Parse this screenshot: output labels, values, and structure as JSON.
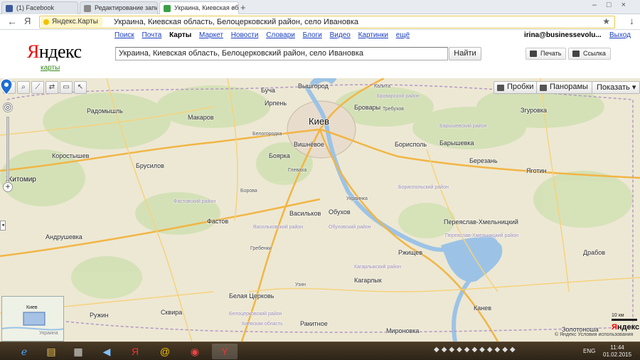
{
  "browser": {
    "tabs": [
      {
        "title": "(1) Facebook",
        "favicon_color": "#3b5998"
      },
      {
        "title": "Редактирование запи",
        "favicon_color": "#8a8a8a"
      },
      {
        "title": "Украина, Киевская об",
        "favicon_color": "#3aa046"
      }
    ],
    "new_tab": "+",
    "window_buttons": "–□×",
    "back": "←",
    "yandex_button": "Я",
    "chip": "Яндекс.Карты",
    "url": "Украина, Киевская область, Белоцерковский район, село Ивановка",
    "star": "★",
    "download": "↓"
  },
  "header": {
    "logo": "Яндекс",
    "logo_first": "Я",
    "logo_rest": "ндекс",
    "logo_sub": "карты",
    "services": [
      "Поиск",
      "Почта",
      "Карты",
      "Маркет",
      "Новости",
      "Словари",
      "Блоги",
      "Видео",
      "Картинки",
      "ещё"
    ],
    "current_service": "Карты",
    "search_value": "Украина, Киевская область, Белоцерковский район, село Ивановка",
    "search_button": "Найти",
    "user": "irina@businessevolu...",
    "logout": "Выход",
    "print": "Печать",
    "link": "Ссылка"
  },
  "map": {
    "controls": {
      "traffic": "Пробки",
      "panoramas": "Панорамы",
      "show": "Показать ▾"
    },
    "tool_icons": [
      "hand-icon",
      "magnifier-icon",
      "ruler-icon",
      "route-icon",
      "comment-icon",
      "pointer-icon"
    ],
    "zoom_plus": "+",
    "zoom_minus": "−",
    "cities_big": [
      "Киев"
    ],
    "labels": [
      {
        "name": "Буча",
        "cls": "lbl"
      },
      {
        "name": "Вышгород",
        "cls": "lbl"
      },
      {
        "name": "Ирпень",
        "cls": "lbl"
      },
      {
        "name": "Киев",
        "cls": "lbl big"
      },
      {
        "name": "Бровары",
        "cls": "lbl"
      },
      {
        "name": "Вишнёвое",
        "cls": "lbl"
      },
      {
        "name": "Борисполь",
        "cls": "lbl"
      },
      {
        "name": "Боярка",
        "cls": "lbl"
      },
      {
        "name": "Васильков",
        "cls": "lbl"
      },
      {
        "name": "Обухов",
        "cls": "lbl"
      },
      {
        "name": "Фастов",
        "cls": "lbl"
      },
      {
        "name": "Макаров",
        "cls": "lbl"
      },
      {
        "name": "Радомышль",
        "cls": "lbl"
      },
      {
        "name": "Коростышев",
        "cls": "lbl"
      },
      {
        "name": "Брусилов",
        "cls": "lbl"
      },
      {
        "name": "Житомир",
        "cls": "lbl med"
      },
      {
        "name": "Андрушевка",
        "cls": "lbl"
      },
      {
        "name": "Белая Церковь",
        "cls": "lbl"
      },
      {
        "name": "Ружин",
        "cls": "lbl"
      },
      {
        "name": "Сквира",
        "cls": "lbl"
      },
      {
        "name": "Ракитное",
        "cls": "lbl"
      },
      {
        "name": "Узин",
        "cls": "lbl"
      },
      {
        "name": "Кагарлык",
        "cls": "lbl"
      },
      {
        "name": "Ржищев",
        "cls": "lbl"
      },
      {
        "name": "Мироновка",
        "cls": "lbl"
      },
      {
        "name": "Канев",
        "cls": "lbl"
      },
      {
        "name": "Переяслав-Хмельницкий",
        "cls": "lbl"
      },
      {
        "name": "Березань",
        "cls": "lbl"
      },
      {
        "name": "Яготин",
        "cls": "lbl"
      },
      {
        "name": "Згуровка",
        "cls": "lbl"
      },
      {
        "name": "Барышевка",
        "cls": "lbl"
      },
      {
        "name": "Драбов",
        "cls": "lbl"
      },
      {
        "name": "Золотоноша",
        "cls": "lbl"
      },
      {
        "name": "Гребенки",
        "cls": "lbl"
      },
      {
        "name": "Белогородка",
        "cls": "lbl"
      },
      {
        "name": "Глеваха",
        "cls": "lbl"
      },
      {
        "name": "Борова",
        "cls": "lbl"
      },
      {
        "name": "Украинка",
        "cls": "lbl"
      },
      {
        "name": "Требухов",
        "cls": "lbl"
      },
      {
        "name": "Калита",
        "cls": "lbl"
      },
      {
        "name": "Макаров",
        "cls": "lbl"
      }
    ],
    "districts": [
      "Фастовский район",
      "Васильковский район",
      "Обуховский район",
      "Кагарлыкский район",
      "Белоцерковский район",
      "Киевская область",
      "Бориспольский район",
      "Барышевский район",
      "Переяслав-Хмельницкий район",
      "Броварской район"
    ],
    "mini_label": "Киев",
    "mini_country": "Украина",
    "scale": "10 км",
    "copyright": "© Яндекс Условия использования",
    "brand": "Яндекс"
  },
  "taskbar": {
    "apps": [
      "ie-icon",
      "explorer-icon",
      "calculator-icon",
      "volume-icon",
      "yandex-browser-icon",
      "mail-icon",
      "chrome-icon",
      "yandex-icon"
    ],
    "lang": "ENG",
    "time": "11:44",
    "date": "01.02.2015"
  }
}
